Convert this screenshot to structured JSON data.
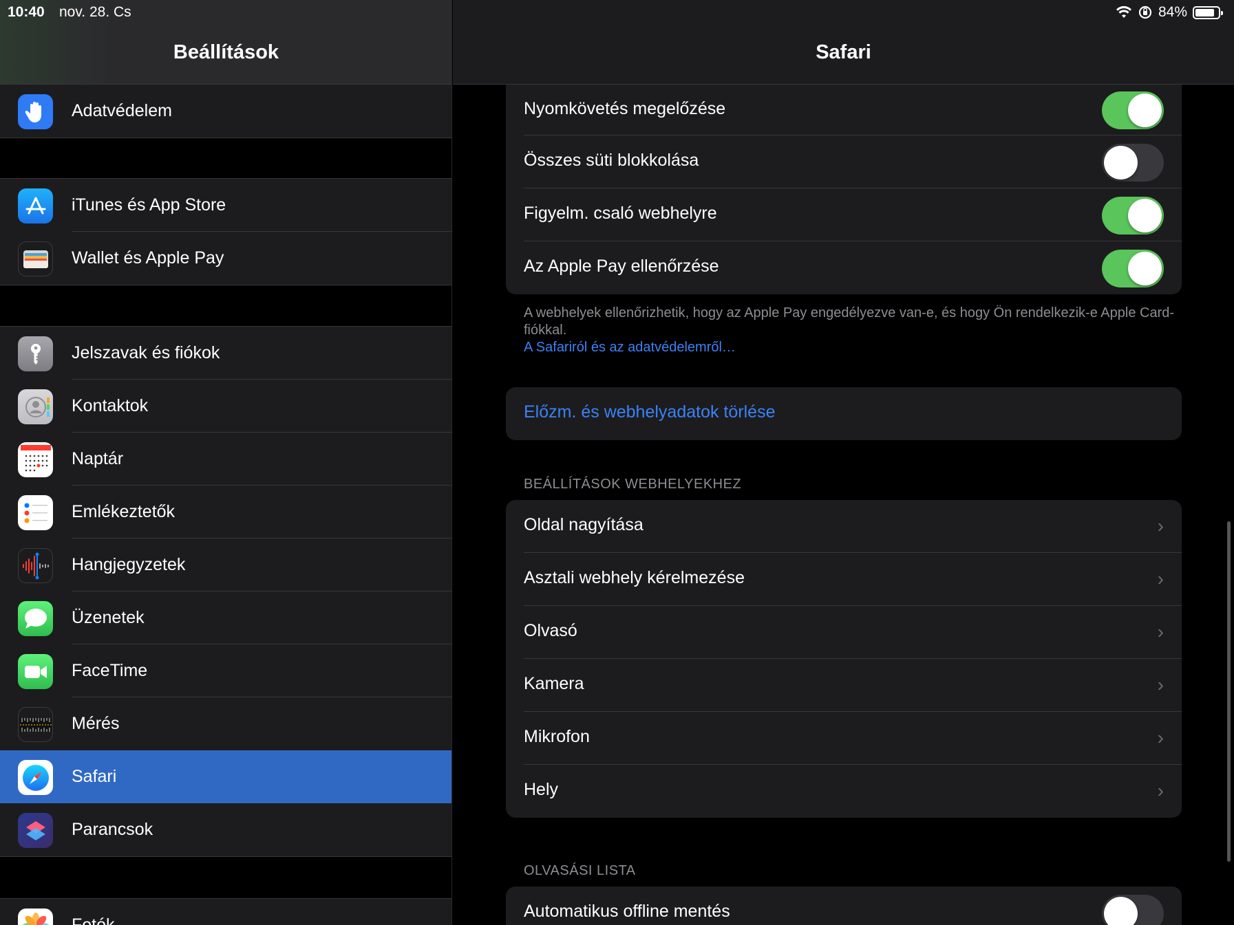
{
  "status": {
    "time": "10:40",
    "date": "nov. 28. Cs",
    "battery": "84%",
    "battery_level": 0.84
  },
  "sidebar": {
    "title": "Beállítások",
    "items": [
      {
        "label": "Adatvédelem",
        "icon": "hand-icon",
        "color": "#2f7bf6"
      },
      {
        "label": "iTunes és App Store",
        "icon": "app-store-icon",
        "color": "#1a9bf6"
      },
      {
        "label": "Wallet és Apple Pay",
        "icon": "wallet-icon",
        "color": "#1c1c1e"
      },
      {
        "label": "Jelszavak és fiókok",
        "icon": "key-icon",
        "color": "#8e8e93"
      },
      {
        "label": "Kontaktok",
        "icon": "contacts-icon",
        "color": "#c7c7cc"
      },
      {
        "label": "Naptár",
        "icon": "calendar-icon",
        "color": "#ffffff"
      },
      {
        "label": "Emlékeztetők",
        "icon": "reminders-icon",
        "color": "#ffffff"
      },
      {
        "label": "Hangjegyzetek",
        "icon": "voice-memos-icon",
        "color": "#1c1c1e"
      },
      {
        "label": "Üzenetek",
        "icon": "messages-icon",
        "color": "#34c759"
      },
      {
        "label": "FaceTime",
        "icon": "facetime-icon",
        "color": "#34c759"
      },
      {
        "label": "Mérés",
        "icon": "measure-icon",
        "color": "#1c1c1e"
      },
      {
        "label": "Safari",
        "icon": "safari-icon",
        "color": "#ffffff",
        "selected": true
      },
      {
        "label": "Parancsok",
        "icon": "shortcuts-icon",
        "color": "#2b3a8a"
      },
      {
        "label": "Fotók",
        "icon": "photos-icon",
        "color": "#ffffff"
      }
    ]
  },
  "detail": {
    "title": "Safari",
    "privacy_rows": [
      {
        "label": "Nyomkövetés megelőzése",
        "on": true
      },
      {
        "label": "Összes süti blokkolása",
        "on": false
      },
      {
        "label": "Figyelm. csaló webhelyre",
        "on": true
      },
      {
        "label": "Az Apple Pay ellenőrzése",
        "on": true
      }
    ],
    "footnote": "A webhelyek ellenőrizhetik, hogy az Apple Pay engedélyezve van-e, és hogy Ön rendelkezik-e Apple Card-fiókkal.",
    "footnote_link": "A Safariról és az adatvédelemről…",
    "clear_history": "Előzm. és webhelyadatok törlése",
    "website_settings_header": "BEÁLLÍTÁSOK WEBHELYEKHEZ",
    "website_settings": [
      "Oldal nagyítása",
      "Asztali webhely kérelmezése",
      "Olvasó",
      "Kamera",
      "Mikrofon",
      "Hely"
    ],
    "reading_list_header": "OLVASÁSI LISTA",
    "reading_list_row": {
      "label": "Automatikus offline mentés",
      "on": false
    },
    "accent": "#3b82f6",
    "toggle_on_color": "#5ac55a"
  }
}
